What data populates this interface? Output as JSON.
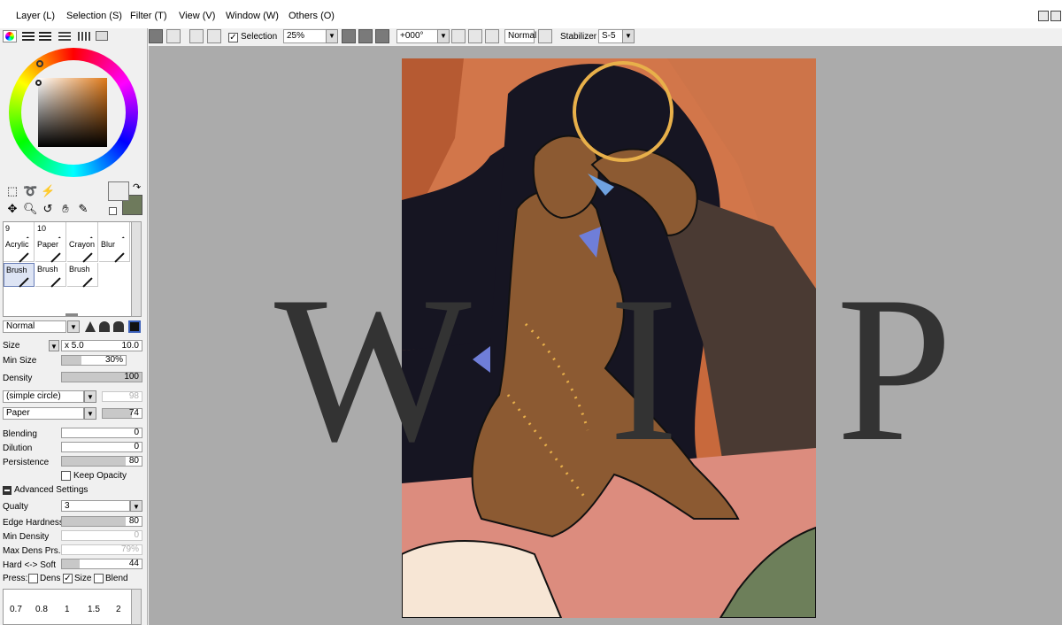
{
  "menu": [
    "Layer (L)",
    "Selection (S)",
    "Filter (T)",
    "View (V)",
    "Window (W)",
    "Others (O)"
  ],
  "toolbar": {
    "selection_label": "Selection",
    "zoom": "25%",
    "rotation": "+000°",
    "blend": "Normal",
    "stabilizer_label": "Stabilizer",
    "stabilizer_value": "S-5"
  },
  "brush_grid": {
    "row1": [
      "9",
      "10",
      "",
      ""
    ],
    "row2": [
      "Acrylic",
      "Paper",
      "Crayon",
      "Blur"
    ],
    "row3": [
      "Brush",
      "Brush",
      "Brush",
      ""
    ]
  },
  "brush_settings": {
    "mode": "Normal",
    "size_label": "Size",
    "size_mult": "x 5.0",
    "size_value": "10.0",
    "min_size_label": "Min Size",
    "min_size_value": "30%",
    "min_size_fraction": 0.3,
    "density_label": "Density",
    "density_value": "100",
    "shape": "(simple circle)",
    "shape_value": "98",
    "texture": "Paper",
    "texture_value": "74",
    "blending_label": "Blending",
    "blending_value": "0",
    "dilution_label": "Dilution",
    "dilution_value": "0",
    "persistence_label": "Persistence",
    "persistence_value": "80",
    "keep_opacity_label": "Keep Opacity",
    "advanced_label": "Advanced Settings",
    "quality_label": "Qualty",
    "quality_value": "3",
    "edge_label": "Edge Hardness",
    "edge_value": "80",
    "min_density_label": "Min Density",
    "min_density_value": "0",
    "max_dens_label": "Max Dens Prs.",
    "max_dens_value": "79%",
    "hard_soft_label": "Hard <-> Soft",
    "hard_soft_value": "44",
    "press_label": "Press:",
    "press_dens": "Dens",
    "press_size": "Size",
    "press_blend": "Blend"
  },
  "size_presets": [
    "0.7",
    "0.8",
    "1",
    "1.5",
    "2"
  ],
  "watermark": [
    "W",
    "I",
    "P"
  ],
  "colors": {
    "primary": "#ececec",
    "secondary": "#6e7a5c"
  }
}
